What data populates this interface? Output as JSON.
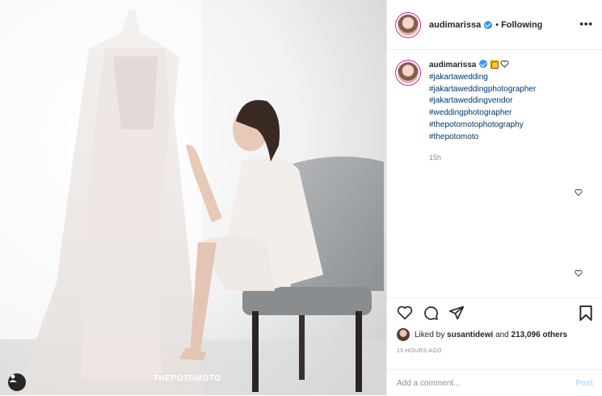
{
  "post": {
    "username": "audimarissa",
    "separator": "•",
    "follow_status": "Following",
    "more_icon": "more-horizontal-icon",
    "photo_watermark": "THEPOTOMOTO",
    "caption": {
      "username": "audimarissa",
      "hashtags": [
        "#jakartawedding",
        "#jakartaweddingphotographer",
        "#jakartaweddingvendor",
        "#weddingphotographer",
        "#thepotomotophotography",
        "#thepotomoto"
      ],
      "time": "15h"
    },
    "likes": {
      "prefix": "Liked by",
      "user": "susantidewi",
      "joiner": "and",
      "others": "213,096 others"
    },
    "posted_ago": "15 HOURS AGO",
    "comment": {
      "placeholder": "Add a comment...",
      "post_label": "Post"
    }
  },
  "colors": {
    "link": "#00376b",
    "verified": "#3897f0",
    "muted": "#8e8e8e",
    "post_disabled": "#b2dffc"
  }
}
